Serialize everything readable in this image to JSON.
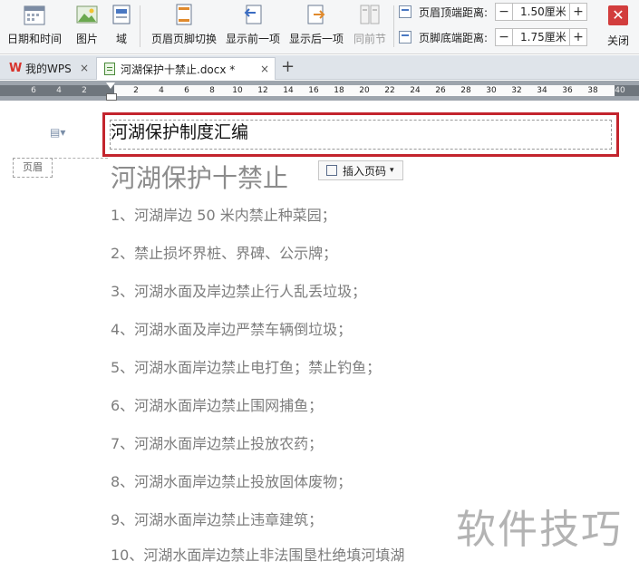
{
  "toolbar": {
    "date_time": "日期和时间",
    "picture": "图片",
    "field": "域",
    "header_footer_switch": "页眉页脚切换",
    "show_prev": "显示前一项",
    "show_next": "显示后一项",
    "same_as_prev": "同前节",
    "header_top_label": "页眉顶端距离:",
    "header_top_value": "1.50厘米",
    "footer_bottom_label": "页脚底端距离:",
    "footer_bottom_value": "1.75厘米",
    "minus": "−",
    "plus": "+",
    "close_label": "关闭",
    "close_glyph": "✕"
  },
  "tabs": {
    "tab1": "我的WPS",
    "tab2": "河湖保护十禁止.docx *",
    "close_glyph": "×",
    "new_tab": "+"
  },
  "ruler": {
    "ticks": [
      "6",
      "4",
      "2",
      "2",
      "4",
      "6",
      "8",
      "10",
      "12",
      "14",
      "16",
      "18",
      "20",
      "22",
      "24",
      "26",
      "28",
      "30",
      "32",
      "34",
      "36",
      "38",
      "40"
    ]
  },
  "document": {
    "header_tag": "页眉",
    "header_text": "河湖保护制度汇编",
    "insert_page_number": "插入页码",
    "title": "河湖保护十禁止",
    "items": [
      "1、河湖岸边 50 米内禁止种菜园；",
      "2、禁止损坏界桩、界碑、公示牌；",
      "3、河湖水面及岸边禁止行人乱丢垃圾；",
      "4、河湖水面及岸边严禁车辆倒垃圾；",
      "5、河湖水面岸边禁止电打鱼；禁止钓鱼；",
      "6、河湖水面岸边禁止围网捕鱼；",
      "7、河湖水面岸边禁止投放农药；",
      "8、河湖水面岸边禁止投放固体废物；",
      "9、河湖水面岸边禁止违章建筑；",
      "10、河湖水面岸边禁止非法围垦杜绝填河填湖"
    ]
  },
  "watermark": "软件技巧"
}
